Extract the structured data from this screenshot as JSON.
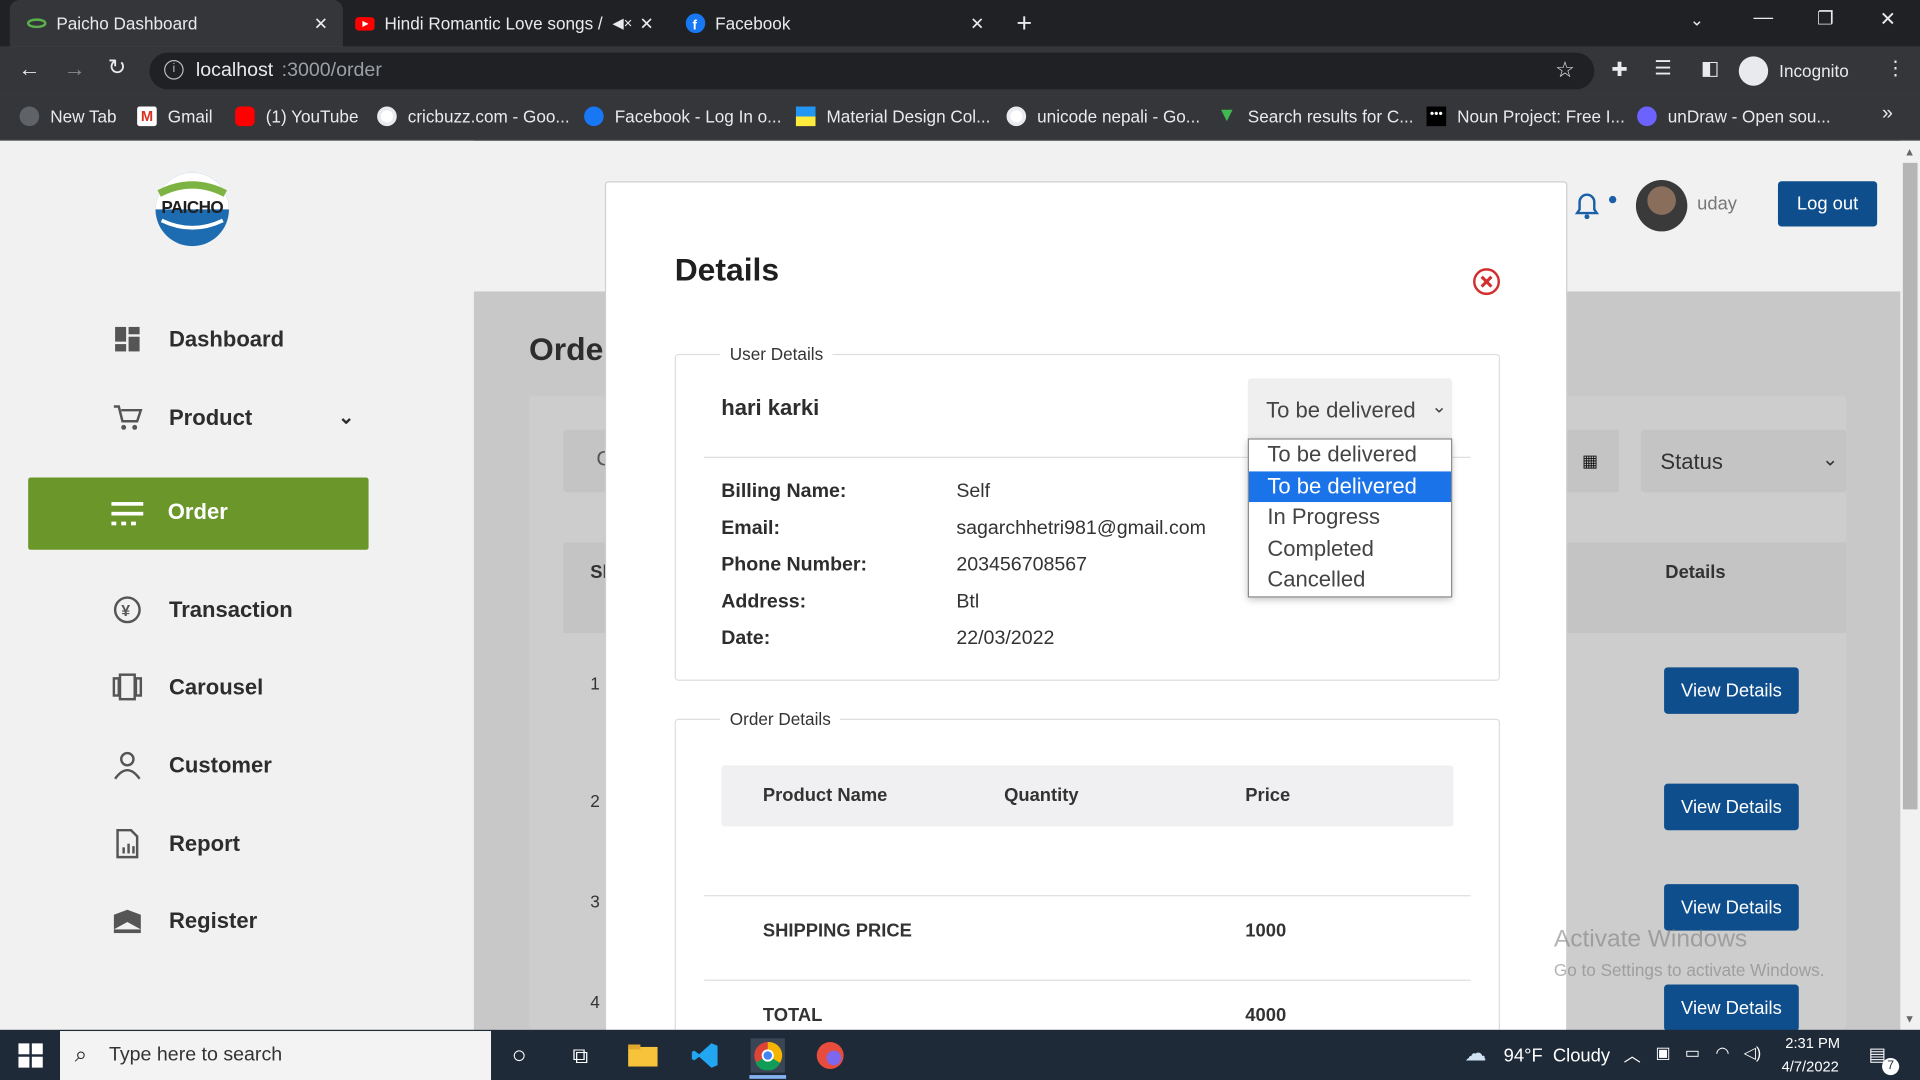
{
  "browser": {
    "tabs": [
      {
        "title": "Paicho Dashboard",
        "active": true
      },
      {
        "title": "Hindi Romantic Love songs /",
        "active": false
      },
      {
        "title": "Facebook",
        "active": false
      }
    ],
    "url_host": "localhost",
    "url_path": ":3000/order",
    "profile": "Incognito",
    "bookmarks": [
      "New Tab",
      "Gmail",
      "(1) YouTube",
      "cricbuzz.com - Goo...",
      "Facebook - Log In o...",
      "Material Design Col...",
      "unicode nepali - Go...",
      "Search results for C...",
      "Noun Project: Free I...",
      "unDraw - Open sou..."
    ]
  },
  "header": {
    "logo_text": "PAICHO",
    "username": "uday",
    "logout_label": "Log out"
  },
  "sidebar": {
    "items": [
      {
        "label": "Dashboard",
        "icon": "dashboard-icon"
      },
      {
        "label": "Product",
        "icon": "cart-icon"
      },
      {
        "label": "Order",
        "icon": "order-icon",
        "active": true
      },
      {
        "label": "Transaction",
        "icon": "transaction-icon"
      },
      {
        "label": "Carousel",
        "icon": "carousel-icon"
      },
      {
        "label": "Customer",
        "icon": "customer-icon"
      },
      {
        "label": "Report",
        "icon": "report-icon"
      },
      {
        "label": "Register",
        "icon": "register-icon"
      }
    ],
    "active_color": "#6a962a"
  },
  "main": {
    "title_partial": "Orde",
    "search_partial": "C",
    "status_filter": "Status",
    "col_sn_partial": "Sl",
    "col_details": "Details",
    "row_numbers": [
      "1",
      "2",
      "3",
      "4"
    ],
    "view_details_label": "View Details"
  },
  "modal": {
    "title": "Details",
    "user_section": "User Details",
    "customer_name": "hari karki",
    "status_value": "To be delivered",
    "status_options": [
      "To be delivered",
      "To be delivered",
      "In Progress",
      "Completed",
      "Cancelled"
    ],
    "selected_option_index": 1,
    "fields": [
      {
        "label": "Billing Name:",
        "value": "Self"
      },
      {
        "label": "Email:",
        "value": "sagarchhetri981@gmail.com"
      },
      {
        "label": "Phone Number:",
        "value": "203456708567"
      },
      {
        "label": "Address:",
        "value": "Btl"
      },
      {
        "label": "Date:",
        "value": "22/03/2022"
      }
    ],
    "order_section": "Order Details",
    "order_headers": [
      "Product Name",
      "Quantity",
      "Price"
    ],
    "shipping_label": "SHIPPING PRICE",
    "shipping_value": "1000",
    "total_label": "TOTAL",
    "total_value": "4000"
  },
  "watermark": {
    "line1": "Activate Windows",
    "line2": "Go to Settings to activate Windows."
  },
  "taskbar": {
    "search_placeholder": "Type here to search",
    "weather": "94°F  Cloudy",
    "time": "2:31 PM",
    "date": "4/7/2022",
    "notifications": "7"
  },
  "colors": {
    "primary_button": "#0f4e8c",
    "sidebar_active": "#6a962a",
    "close_icon": "#d32f2f",
    "dropdown_selected": "#1a73e8"
  }
}
